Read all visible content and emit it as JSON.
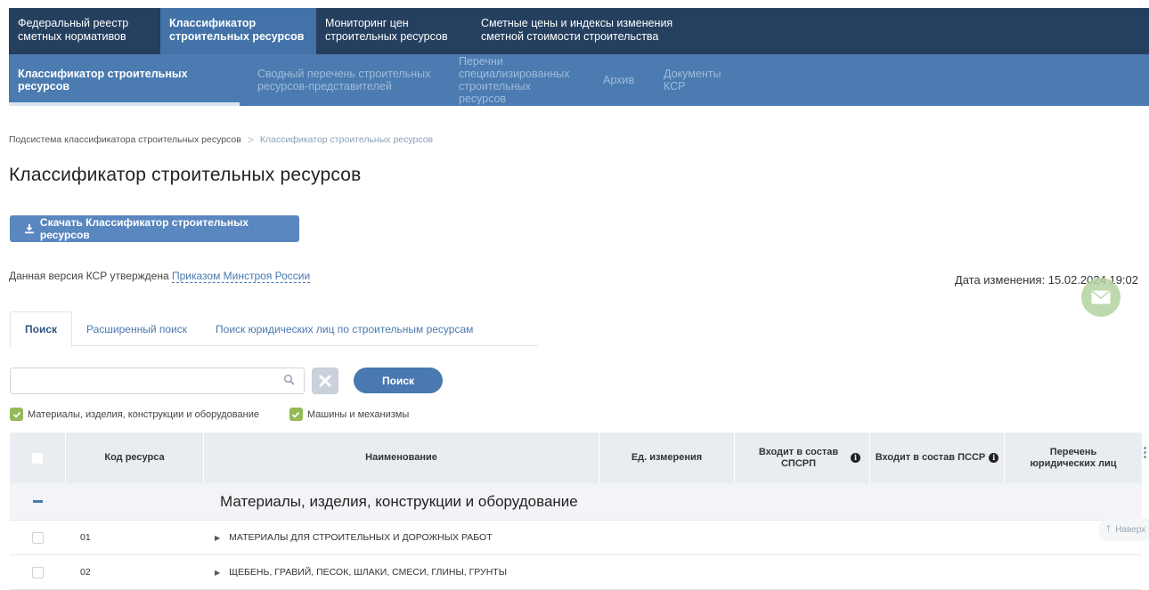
{
  "topnav": {
    "items": [
      {
        "label": "Федеральный реестр\nсметных нормативов"
      },
      {
        "label": "Классификатор\nстроительных ресурсов"
      },
      {
        "label": "Мониторинг цен\nстроительных ресурсов"
      },
      {
        "label": "Сметные цены и индексы изменения\nсметной стоимости строительства"
      }
    ]
  },
  "subnav": {
    "items": [
      {
        "label": "Классификатор строительных ресурсов"
      },
      {
        "label": "Сводный перечень строительных ресурсов-представителей"
      },
      {
        "label": "Перечни специализированных строительных ресурсов"
      },
      {
        "label": "Архив"
      },
      {
        "label": "Документы КСР"
      }
    ]
  },
  "breadcrumb": {
    "root": "Подсистема классификатора строительных ресурсов",
    "separator": ">",
    "current": "Классификатор строительных ресурсов"
  },
  "page_title": "Классификатор строительных ресурсов",
  "download_button": "Скачать Классификатор строительных ресурсов",
  "approved": {
    "text": "Данная версия КСР утверждена ",
    "link": "Приказом Минстроя России"
  },
  "changed": "Дата изменения: 15.02.2024 19:02",
  "tabs": [
    {
      "label": "Поиск"
    },
    {
      "label": "Расширенный поиск"
    },
    {
      "label": "Поиск юридических лиц по строительным ресурсам"
    }
  ],
  "search": {
    "value": "",
    "placeholder": "",
    "button": "Поиск"
  },
  "filters": [
    {
      "label": "Материалы, изделия, конструкции и оборудование",
      "checked": true
    },
    {
      "label": "Машины и механизмы",
      "checked": true
    }
  ],
  "table": {
    "headers": {
      "code": "Код ресурса",
      "name": "Наименование",
      "unit": "Ед. измерения",
      "spsrp": "Входит в состав СПСРП",
      "pssr": "Входит в состав ПССР",
      "legal": "Перечень юридических лиц"
    },
    "group_title": "Материалы, изделия, конструкции и оборудование",
    "rows": [
      {
        "code": "01",
        "name": "МАТЕРИАЛЫ ДЛЯ СТРОИТЕЛЬНЫХ И ДОРОЖНЫХ РАБОТ"
      },
      {
        "code": "02",
        "name": "ЩЕБЕНЬ, ГРАВИЙ, ПЕСОК, ШЛАКИ, СМЕСИ, ГЛИНЫ, ГРУНТЫ"
      }
    ]
  },
  "totop": "Наверх",
  "colors": {
    "topnav_bg": "#253f5f",
    "topnav_active": "#4272a7",
    "subnav_bg": "#4b7bb0",
    "accent": "#4a78b0",
    "check_green": "#93ba56"
  }
}
